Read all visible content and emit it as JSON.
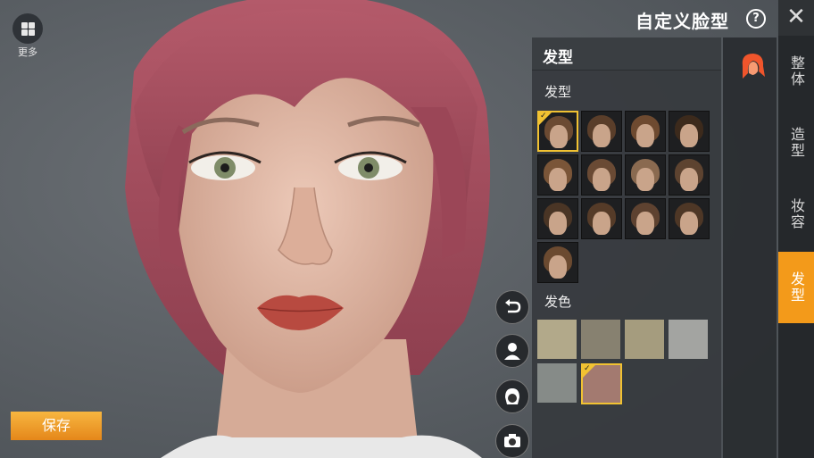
{
  "top_left": {
    "more_label": "更多"
  },
  "header": {
    "title": "自定义脸型",
    "help_symbol": "?",
    "close_symbol": "✕"
  },
  "tabs": [
    {
      "label": "整体",
      "active": false
    },
    {
      "label": "造型",
      "active": false
    },
    {
      "label": "妆容",
      "active": false
    },
    {
      "label": "发型",
      "active": true
    }
  ],
  "panel": {
    "title": "发型",
    "hairstyle_label": "发型",
    "haircolor_label": "发色",
    "hairstyles": [
      {
        "hair": "#6b4a32",
        "selected": true
      },
      {
        "hair": "#5a3e2a",
        "selected": false
      },
      {
        "hair": "#6e4a30",
        "selected": false
      },
      {
        "hair": "#3c2a1c",
        "selected": false
      },
      {
        "hair": "#7a5538",
        "selected": false
      },
      {
        "hair": "#6a4a34",
        "selected": false
      },
      {
        "hair": "#8a6a50",
        "selected": false
      },
      {
        "hair": "#5d4330",
        "selected": false
      },
      {
        "hair": "#4a3525",
        "selected": false
      },
      {
        "hair": "#553b28",
        "selected": false
      },
      {
        "hair": "#5e4230",
        "selected": false
      },
      {
        "hair": "#4e3726",
        "selected": false
      },
      {
        "hair": "#6b4a30",
        "selected": false
      }
    ],
    "colors": [
      {
        "color": "#b2a98a",
        "selected": false
      },
      {
        "color": "#878170",
        "selected": false
      },
      {
        "color": "#a59c7e",
        "selected": false
      },
      {
        "color": "#a3a4a1",
        "selected": false
      },
      {
        "color": "#868b88",
        "selected": false
      },
      {
        "color": "#a37a70",
        "selected": true
      }
    ]
  },
  "save_label": "保存",
  "colors": {
    "accent": "#f39a1a",
    "select": "#f1c232",
    "hair_pink": "#a84e5e"
  }
}
